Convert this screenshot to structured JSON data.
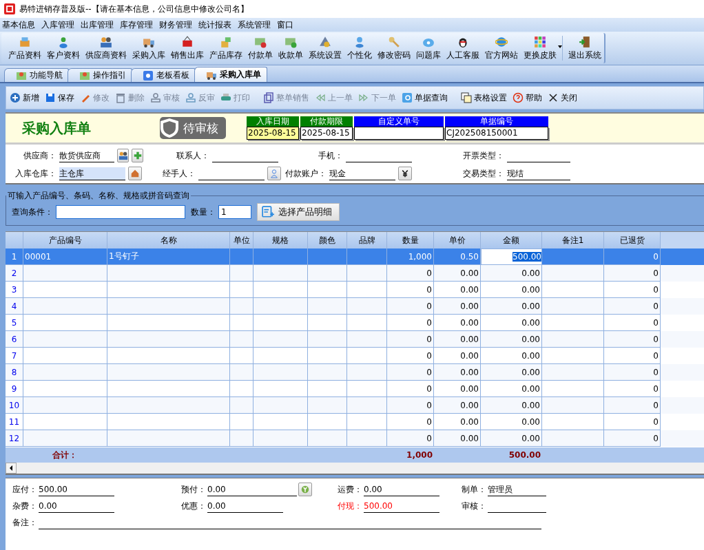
{
  "window": {
    "title": "易特进销存普及版--【请在基本信息，公司信息中修改公司名】"
  },
  "menu": [
    "基本信息",
    "入库管理",
    "出库管理",
    "库存管理",
    "财务管理",
    "统计报表",
    "系统管理",
    "窗口"
  ],
  "toolbar": [
    {
      "label": "产品资料",
      "kind": "tool"
    },
    {
      "label": "客户资料",
      "kind": "tool"
    },
    {
      "label": "供应商资料",
      "kind": "tool"
    },
    {
      "label": "采购入库",
      "kind": "tool"
    },
    {
      "label": "销售出库",
      "kind": "tool"
    },
    {
      "label": "产品库存",
      "kind": "tool"
    },
    {
      "label": "付款单",
      "kind": "tool"
    },
    {
      "label": "收款单",
      "kind": "tool"
    },
    {
      "label": "系统设置",
      "kind": "tool"
    },
    {
      "label": "个性化",
      "kind": "tool"
    },
    {
      "label": "修改密码",
      "kind": "tool"
    },
    {
      "label": "问题库",
      "kind": "tool"
    },
    {
      "label": "人工客服",
      "kind": "tool"
    },
    {
      "label": "官方网站",
      "kind": "tool"
    },
    {
      "label": "更换皮肤",
      "kind": "dropdown"
    },
    {
      "label": "退出系统",
      "kind": "exit"
    }
  ],
  "tabs": [
    {
      "label": "功能导航",
      "selected": false
    },
    {
      "label": "操作指引",
      "selected": false
    },
    {
      "label": "老板看板",
      "selected": false
    },
    {
      "label": "采购入库单",
      "selected": true
    }
  ],
  "actions": [
    {
      "label": "新增",
      "disabled": false
    },
    {
      "label": "保存",
      "disabled": false
    },
    {
      "label": "修改",
      "disabled": true
    },
    {
      "label": "删除",
      "disabled": true
    },
    {
      "label": "审核",
      "disabled": true
    },
    {
      "label": "反审",
      "disabled": true
    },
    {
      "label": "打印",
      "disabled": true
    },
    {
      "label": "整单销售",
      "disabled": true
    },
    {
      "label": "上一单",
      "disabled": true
    },
    {
      "label": "下一单",
      "disabled": true
    },
    {
      "label": "单据查询",
      "disabled": false
    },
    {
      "label": "表格设置",
      "disabled": false
    },
    {
      "label": "帮助",
      "disabled": false
    },
    {
      "label": "关闭",
      "disabled": false
    }
  ],
  "form": {
    "title": "采购入库单",
    "status": "待审核",
    "header_fields": [
      {
        "label": "入库日期",
        "value": "2025-08-15",
        "color": "#008000",
        "focused": true
      },
      {
        "label": "付款期限",
        "value": "2025-08-15",
        "color": "#008000",
        "focused": false
      },
      {
        "label": "自定义单号",
        "color": "#0000ff",
        "focused": false
      },
      {
        "label": "单据编号",
        "value": "CJ202508150001",
        "color": "#0000ff",
        "focused": false
      }
    ],
    "rows": [
      [
        {
          "label": "供应商：",
          "value": "散货供应商",
          "kind": "supplier"
        },
        {
          "label": "联系人：",
          "kind": "plain"
        },
        {
          "label": "手机：",
          "kind": "plain"
        },
        {
          "label": "开票类型：",
          "kind": "plain"
        }
      ],
      [
        {
          "label": "入库仓库：",
          "value": "主仓库",
          "kind": "warehouse"
        },
        {
          "label": "经手人：",
          "kind": "person"
        },
        {
          "label": "付款账户：",
          "value": "现金",
          "kind": "account"
        },
        {
          "label": "交易类型：",
          "value": "现结",
          "kind": "plain"
        }
      ]
    ]
  },
  "query": {
    "group_label": "可输入产品编号、条码、名称、规格或拼音码查询",
    "condition_label": "查询条件：",
    "quantity_label": "数量：",
    "quantity": "1",
    "button": "选择产品明细"
  },
  "table": {
    "columns": [
      {
        "label": "产品编号",
        "editing": false
      },
      {
        "label": "名称",
        "editing": false
      },
      {
        "label": "单位",
        "editing": false
      },
      {
        "label": "规格",
        "editing": false
      },
      {
        "label": "颜色",
        "editing": false
      },
      {
        "label": "品牌",
        "editing": false
      },
      {
        "label": "数量",
        "editing": false
      },
      {
        "label": "单价",
        "editing": false
      },
      {
        "label": "金额",
        "editing": true
      },
      {
        "label": "备注1",
        "editing": false
      },
      {
        "label": "已退货",
        "editing": false
      }
    ],
    "rows": [
      {
        "number": "1",
        "selected": true,
        "cells": [
          "00001",
          "1号钉子",
          "",
          "",
          "",
          "",
          "1,000",
          "0.50",
          "500.00",
          "",
          "0"
        ]
      },
      {
        "number": "2",
        "selected": false,
        "cells": [
          "",
          "",
          "",
          "",
          "",
          "",
          "0",
          "0.00",
          "0.00",
          "",
          "0"
        ]
      },
      {
        "number": "3",
        "selected": false,
        "cells": [
          "",
          "",
          "",
          "",
          "",
          "",
          "0",
          "0.00",
          "0.00",
          "",
          "0"
        ]
      },
      {
        "number": "4",
        "selected": false,
        "cells": [
          "",
          "",
          "",
          "",
          "",
          "",
          "0",
          "0.00",
          "0.00",
          "",
          "0"
        ]
      },
      {
        "number": "5",
        "selected": false,
        "cells": [
          "",
          "",
          "",
          "",
          "",
          "",
          "0",
          "0.00",
          "0.00",
          "",
          "0"
        ]
      },
      {
        "number": "6",
        "selected": false,
        "cells": [
          "",
          "",
          "",
          "",
          "",
          "",
          "0",
          "0.00",
          "0.00",
          "",
          "0"
        ]
      },
      {
        "number": "7",
        "selected": false,
        "cells": [
          "",
          "",
          "",
          "",
          "",
          "",
          "0",
          "0.00",
          "0.00",
          "",
          "0"
        ]
      },
      {
        "number": "8",
        "selected": false,
        "cells": [
          "",
          "",
          "",
          "",
          "",
          "",
          "0",
          "0.00",
          "0.00",
          "",
          "0"
        ]
      },
      {
        "number": "9",
        "selected": false,
        "cells": [
          "",
          "",
          "",
          "",
          "",
          "",
          "0",
          "0.00",
          "0.00",
          "",
          "0"
        ]
      },
      {
        "number": "10",
        "selected": false,
        "cells": [
          "",
          "",
          "",
          "",
          "",
          "",
          "0",
          "0.00",
          "0.00",
          "",
          "0"
        ]
      },
      {
        "number": "11",
        "selected": false,
        "cells": [
          "",
          "",
          "",
          "",
          "",
          "",
          "0",
          "0.00",
          "0.00",
          "",
          "0"
        ]
      },
      {
        "number": "12",
        "selected": false,
        "cells": [
          "",
          "",
          "",
          "",
          "",
          "",
          "0",
          "0.00",
          "0.00",
          "",
          "0"
        ]
      }
    ],
    "totals": {
      "label": "合计：",
      "cells": [
        "",
        "",
        "",
        "",
        "",
        "",
        "1,000",
        "",
        "500.00",
        "",
        ""
      ]
    }
  },
  "footer": [
    [
      {
        "label": "应付：",
        "value": "500.00",
        "alert": false,
        "kind": "field"
      },
      {
        "label": "预付：",
        "value": "0.00",
        "alert": false,
        "kind": "button"
      },
      {
        "label": "运费：",
        "value": "0.00",
        "alert": false,
        "kind": "field"
      },
      {
        "label": "制单：",
        "value": "管理员",
        "alert": false,
        "kind": "short"
      }
    ],
    [
      {
        "label": "杂费：",
        "value": "0.00",
        "alert": false,
        "kind": "field"
      },
      {
        "label": "优惠：",
        "value": "0.00",
        "alert": false,
        "kind": "field"
      },
      {
        "label": "付现：",
        "value": "500.00",
        "alert": true,
        "kind": "field"
      },
      {
        "label": "审核：",
        "alert": false,
        "kind": "short"
      }
    ],
    [
      {
        "label": "备注：",
        "alert": false,
        "kind": "wide"
      }
    ]
  ]
}
